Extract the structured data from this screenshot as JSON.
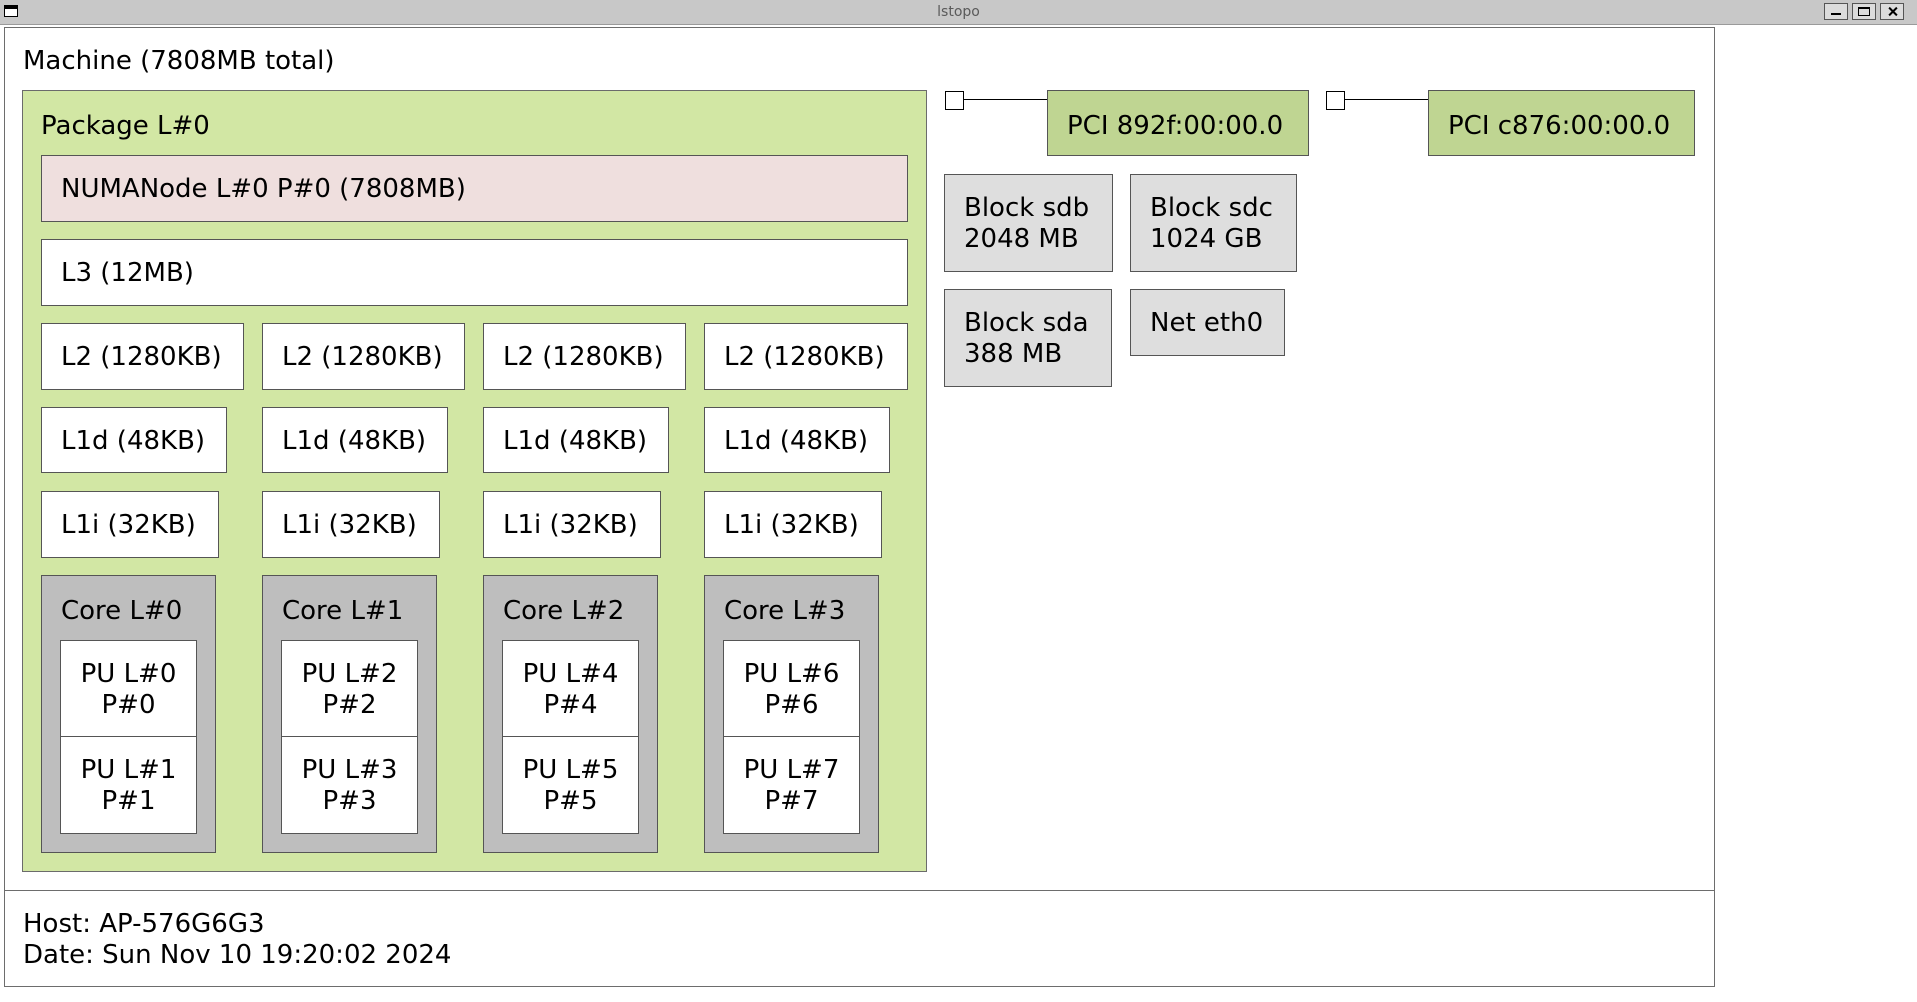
{
  "window": {
    "title": "lstopo",
    "buttons": [
      "minimize",
      "maximize",
      "close"
    ]
  },
  "machine": {
    "label": "Machine (7808MB total)"
  },
  "package": {
    "label": "Package L#0"
  },
  "numa": {
    "label": "NUMANode L#0 P#0 (7808MB)"
  },
  "l3": {
    "label": "L3 (12MB)"
  },
  "l2": [
    "L2 (1280KB)",
    "L2 (1280KB)",
    "L2 (1280KB)",
    "L2 (1280KB)"
  ],
  "l1d": [
    "L1d (48KB)",
    "L1d (48KB)",
    "L1d (48KB)",
    "L1d (48KB)"
  ],
  "l1i": [
    "L1i (32KB)",
    "L1i (32KB)",
    "L1i (32KB)",
    "L1i (32KB)"
  ],
  "cores": [
    {
      "label": "Core L#0",
      "pus": [
        "PU L#0\nP#0",
        "PU L#1\nP#1"
      ]
    },
    {
      "label": "Core L#1",
      "pus": [
        "PU L#2\nP#2",
        "PU L#3\nP#3"
      ]
    },
    {
      "label": "Core L#2",
      "pus": [
        "PU L#4\nP#4",
        "PU L#5\nP#5"
      ]
    },
    {
      "label": "Core L#3",
      "pus": [
        "PU L#6\nP#6",
        "PU L#7\nP#7"
      ]
    }
  ],
  "pci": [
    "PCI 892f:00:00.0",
    "PCI c876:00:00.0"
  ],
  "osdevs": {
    "sdb": "Block sdb\n2048 MB",
    "sdc": "Block sdc\n1024 GB",
    "sda": "Block sda\n388 MB",
    "eth0": "Net eth0"
  },
  "legend": {
    "host": "Host: AP-576G6G3",
    "date": "Date: Sun Nov 10 19:20:02 2024"
  },
  "colors": {
    "package": "#d2e7a4",
    "numa": "#efdfde",
    "core": "#bebebe",
    "pci": "#bfd592",
    "osdev": "#dedede"
  }
}
